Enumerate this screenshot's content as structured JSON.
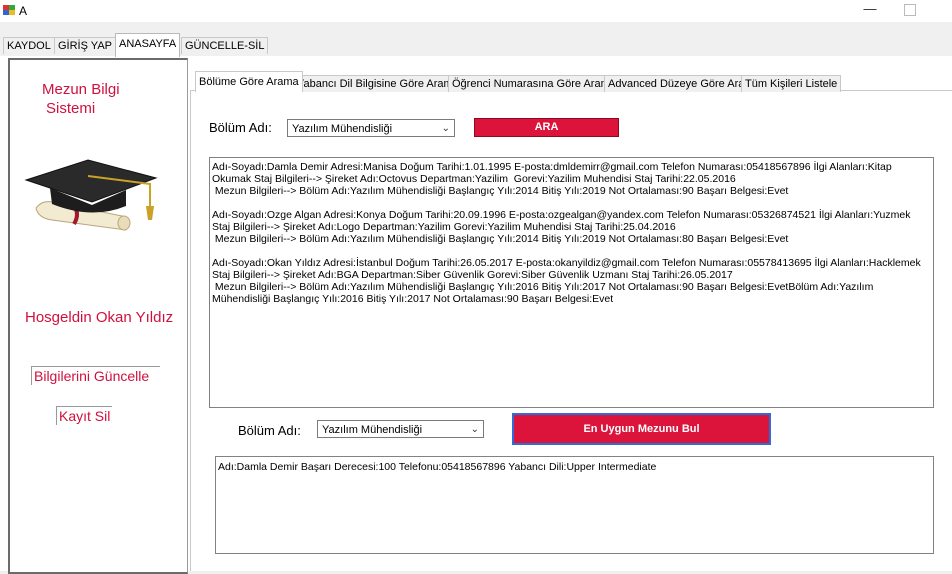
{
  "window": {
    "title": "A"
  },
  "main_tabs": [
    "KAYDOL",
    "GİRİŞ YAP",
    "ANASAYFA",
    "GÜNCELLE-SİL"
  ],
  "sidebar": {
    "system_title_line1": "Mezun Bilgi",
    "system_title_line2": "Sistemi",
    "welcome": "Hosgeldin  Okan Yıldız",
    "update_link": "Bilgilerini Güncelle",
    "delete_link": "Kayıt Sil"
  },
  "inner_tabs": [
    "Bölüme Göre Arama",
    "Yabancı Dil Bilgisine Göre Arama",
    "Öğrenci Numarasına Göre Arama",
    "Advanced Düzeye Göre Ara",
    "Tüm Kişileri Listele"
  ],
  "search": {
    "label": "Bölüm Adı:",
    "selected": "Yazılım Mühendisliği",
    "button": "ARA"
  },
  "results": [
    "Adı-Soyadı:Damla Demir Adresi:Manisa Doğum Tarihi:1.01.1995 E-posta:dmldemirr@gmail.com Telefon Numarası:05418567896 İlgi Alanları:Kitap Okumak Staj Bilgileri--> Şireket Adı:Octovus Departman:Yazilim  Gorevi:Yazilim Muhendisi Staj Tarihi:22.05.2016\n Mezun Bilgileri--> Bölüm Adı:Yazılım Mühendisliği Başlangıç Yılı:2014 Bitiş Yılı:2019 Not Ortalaması:90 Başarı Belgesi:Evet",
    "Adı-Soyadı:Ozge Algan Adresi:Konya Doğum Tarihi:20.09.1996 E-posta:ozgealgan@yandex.com Telefon Numarası:05326874521 İlgi Alanları:Yuzmek Staj Bilgileri--> Şireket Adı:Logo Departman:Yazilim Gorevi:Yazilim Muhendisi Staj Tarihi:25.04.2016\n Mezun Bilgileri--> Bölüm Adı:Yazılım Mühendisliği Başlangıç Yılı:2014 Bitiş Yılı:2019 Not Ortalaması:80 Başarı Belgesi:Evet",
    "Adı-Soyadı:Okan Yıldız Adresi:İstanbul Doğum Tarihi:26.05.2017 E-posta:okanyildiz@gmail.com Telefon Numarası:05578413695 İlgi Alanları:Hacklemek Staj Bilgileri--> Şireket Adı:BGA Departman:Siber Güvenlik Gorevi:Siber Güvenlik Uzmanı Staj Tarihi:26.05.2017\n Mezun Bilgileri--> Bölüm Adı:Yazılım Mühendisliği Başlangıç Yılı:2016 Bitiş Yılı:2017 Not Ortalaması:90 Başarı Belgesi:EvetBölüm Adı:Yazılım Mühendisliği Başlangıç Yılı:2016 Bitiş Yılı:2017 Not Ortalaması:90 Başarı Belgesi:Evet"
  ],
  "best": {
    "label": "Bölüm Adı:",
    "selected": "Yazılım Mühendisliği",
    "button": "En Uygun Mezunu Bul",
    "result": "Adı:Damla Demir Başarı Derecesi:100 Telefonu:05418567896 Yabancı Dili:Upper Intermediate"
  },
  "colors": {
    "accent": "#dc143c",
    "focus": "#2d6dd4"
  }
}
